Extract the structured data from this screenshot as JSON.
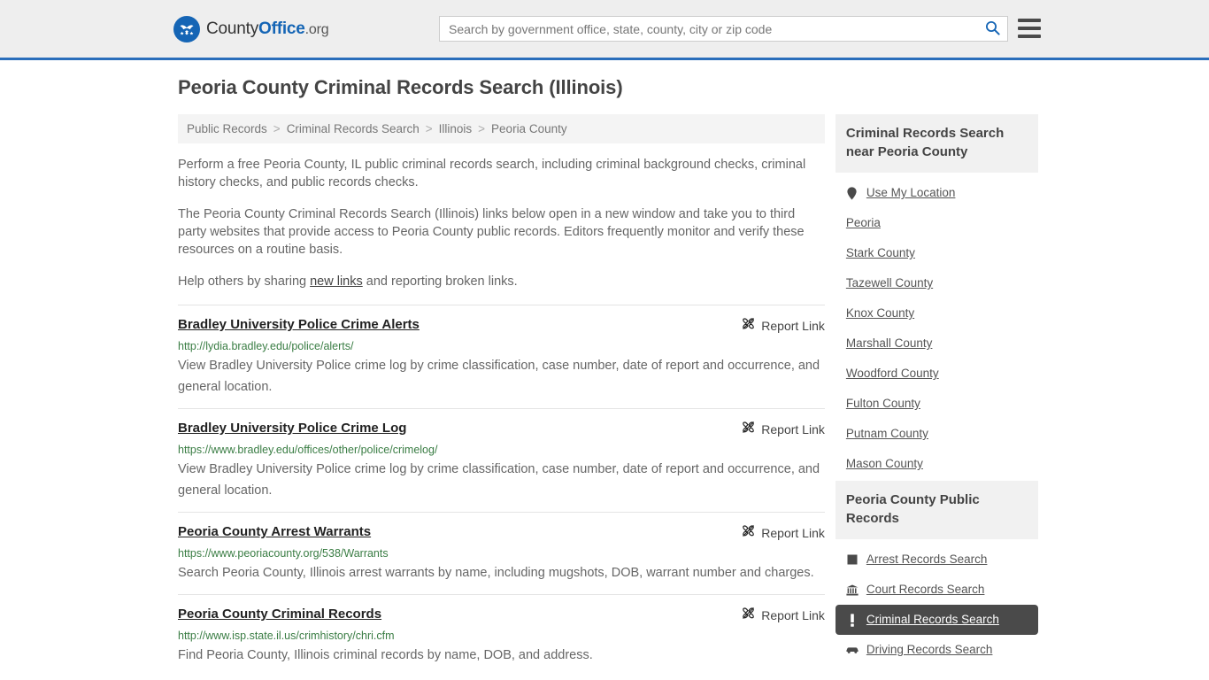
{
  "header": {
    "brand": {
      "part1": "County",
      "part2": "Office",
      "part3": ".org",
      "icon": "eagle-shield-icon"
    },
    "search": {
      "placeholder": "Search by government office, state, county, city or zip code",
      "value": "",
      "button_icon": "search-icon"
    },
    "menu_icon": "hamburger-menu-icon",
    "accent_color": "#2a6ebb",
    "background_color": "#eeeeee"
  },
  "page": {
    "title": "Peoria County Criminal Records Search (Illinois)"
  },
  "breadcrumb": [
    {
      "label": "Public Records"
    },
    {
      "label": "Criminal Records Search"
    },
    {
      "label": "Illinois"
    },
    {
      "label": "Peoria County"
    }
  ],
  "breadcrumb_separator": ">",
  "intro": {
    "p1": "Perform a free Peoria County, IL public criminal records search, including criminal background checks, criminal history checks, and public records checks.",
    "p2": "The Peoria County Criminal Records Search (Illinois) links below open in a new window and take you to third party websites that provide access to Peoria County public records. Editors frequently monitor and verify these resources on a routine basis.",
    "p3_before": "Help others by sharing ",
    "p3_link": "new links",
    "p3_after": " and reporting broken links."
  },
  "report_link_label": "Report Link",
  "report_link_icon": "unlink-icon",
  "results": [
    {
      "title": "Bradley University Police Crime Alerts",
      "url": "http://lydia.bradley.edu/police/alerts/",
      "description": "View Bradley University Police crime log by crime classification, case number, date of report and occurrence, and general location."
    },
    {
      "title": "Bradley University Police Crime Log",
      "url": "https://www.bradley.edu/offices/other/police/crimelog/",
      "description": "View Bradley University Police crime log by crime classification, case number, date of report and occurrence, and general location."
    },
    {
      "title": "Peoria County Arrest Warrants",
      "url": "https://www.peoriacounty.org/538/Warrants",
      "description": "Search Peoria County, Illinois arrest warrants by name, including mugshots, DOB, warrant number and charges."
    },
    {
      "title": "Peoria County Criminal Records",
      "url": "http://www.isp.state.il.us/crimhistory/chri.cfm",
      "description": "Find Peoria County, Illinois criminal records by name, DOB, and address."
    }
  ],
  "sidebar": {
    "nearby": {
      "heading": "Criminal Records Search near Peoria County",
      "items": [
        {
          "label": "Use My Location",
          "icon": "map-pin-icon"
        },
        {
          "label": "Peoria",
          "icon": ""
        },
        {
          "label": "Stark County",
          "icon": ""
        },
        {
          "label": "Tazewell County",
          "icon": ""
        },
        {
          "label": "Knox County",
          "icon": ""
        },
        {
          "label": "Marshall County",
          "icon": ""
        },
        {
          "label": "Woodford County",
          "icon": ""
        },
        {
          "label": "Fulton County",
          "icon": ""
        },
        {
          "label": "Putnam County",
          "icon": ""
        },
        {
          "label": "Mason County",
          "icon": ""
        }
      ]
    },
    "public_records": {
      "heading": "Peoria County Public Records",
      "items": [
        {
          "label": "Arrest Records Search",
          "icon": "fingerprint-card-icon",
          "active": false
        },
        {
          "label": "Court Records Search",
          "icon": "courthouse-icon",
          "active": false
        },
        {
          "label": "Criminal Records Search",
          "icon": "alert-exclamation-icon",
          "active": true
        },
        {
          "label": "Driving Records Search",
          "icon": "car-icon",
          "active": false
        }
      ]
    }
  }
}
